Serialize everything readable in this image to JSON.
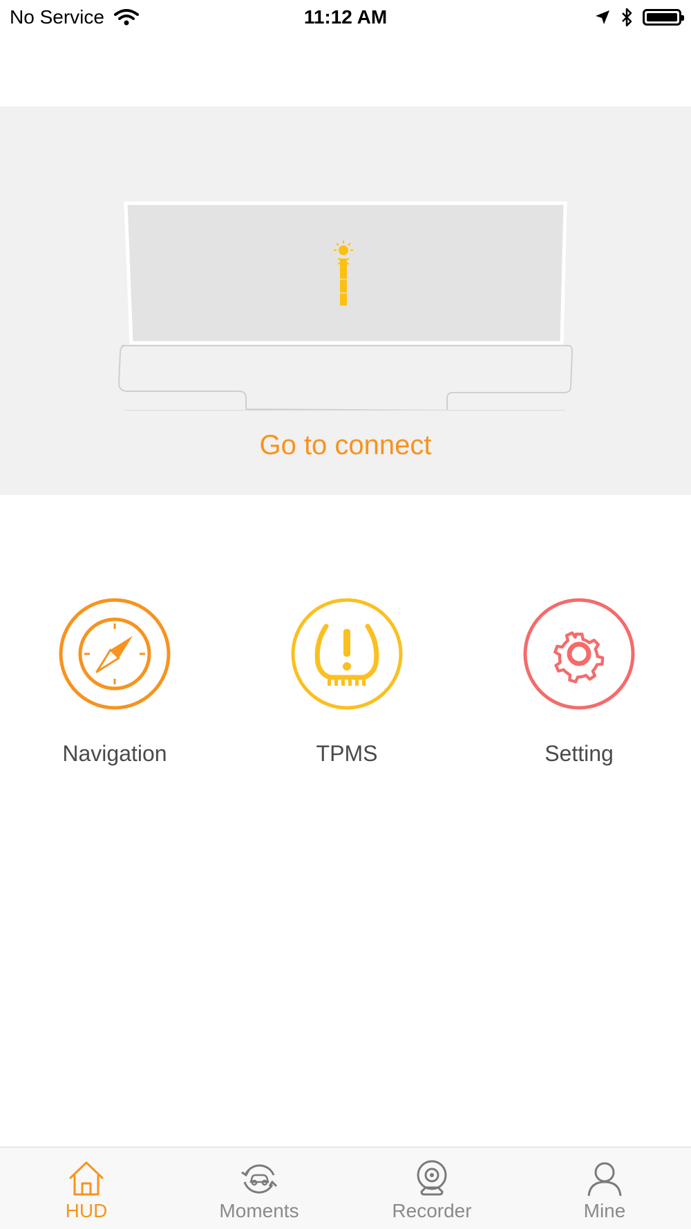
{
  "status_bar": {
    "carrier": "No Service",
    "time": "11:12 AM",
    "icons": [
      "wifi-icon",
      "location-arrow-icon",
      "bluetooth-icon",
      "battery-icon"
    ]
  },
  "hero": {
    "connect_label": "Go to connect"
  },
  "features": [
    {
      "label": "Navigation",
      "icon": "compass-icon",
      "color": "#f7931e"
    },
    {
      "label": "TPMS",
      "icon": "tire-pressure-icon",
      "color": "#fbbf1f"
    },
    {
      "label": "Setting",
      "icon": "gear-icon",
      "color": "#f46b6b"
    }
  ],
  "tabs": [
    {
      "label": "HUD",
      "icon": "home-icon",
      "active": true
    },
    {
      "label": "Moments",
      "icon": "car-cycle-icon",
      "active": false
    },
    {
      "label": "Recorder",
      "icon": "camera-icon",
      "active": false
    },
    {
      "label": "Mine",
      "icon": "person-icon",
      "active": false
    }
  ],
  "colors": {
    "accent": "#f7931e",
    "tpms": "#fbbf1f",
    "setting": "#f46b6b",
    "hud_light": "#fdc011",
    "tab_inactive": "#8a8a8a"
  }
}
